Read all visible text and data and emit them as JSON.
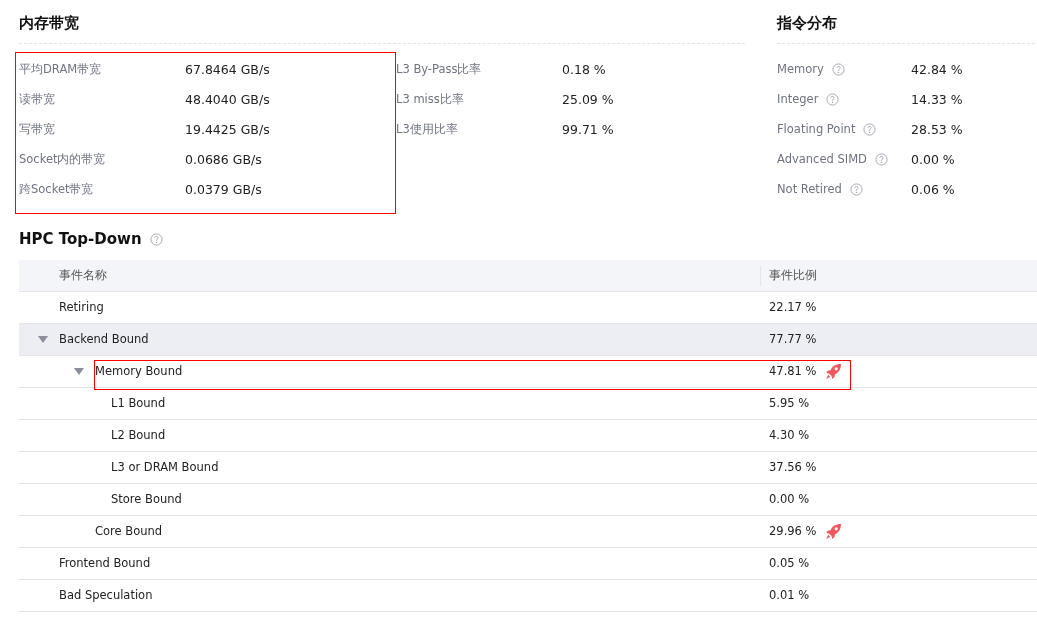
{
  "memory_bandwidth": {
    "title": "内存带宽",
    "group_1": {
      "highlighted": true,
      "items": [
        {
          "label": "平均DRAM带宽",
          "value": "67.8464 GB/s"
        },
        {
          "label": "读带宽",
          "value": "48.4040 GB/s"
        },
        {
          "label": "写带宽",
          "value": "19.4425 GB/s"
        },
        {
          "label": "Socket内的带宽",
          "value": "0.0686 GB/s"
        },
        {
          "label": "跨Socket带宽",
          "value": "0.0379 GB/s"
        }
      ]
    },
    "group_2": {
      "highlighted": false,
      "items": [
        {
          "label": "L3 By-Pass比率",
          "value": "0.18 %"
        },
        {
          "label": "L3 miss比率",
          "value": "25.09 %"
        },
        {
          "label": "L3使用比率",
          "value": "99.71 %"
        }
      ]
    }
  },
  "instruction_distribution": {
    "title": "指令分布",
    "items": [
      {
        "label": "Memory",
        "value": "42.84 %"
      },
      {
        "label": "Integer",
        "value": "14.33 %"
      },
      {
        "label": "Floating Point",
        "value": "28.53 %"
      },
      {
        "label": "Advanced SIMD",
        "value": "0.00 %"
      },
      {
        "label": "Not Retired",
        "value": "0.06 %"
      }
    ]
  },
  "hpc_top_down": {
    "title": "HPC Top-Down",
    "columns": [
      "事件名称",
      "事件比例"
    ],
    "rows": [
      {
        "name": "Retiring",
        "value": "22.17 %",
        "shaded": false,
        "highlighted": false,
        "alert": false
      },
      {
        "name": "Backend Bound",
        "value": "77.77 %",
        "expanded": true,
        "shaded": true,
        "highlighted": false,
        "alert": false,
        "children": [
          {
            "name": "Memory Bound",
            "value": "47.81 %",
            "expanded": true,
            "shaded": false,
            "highlighted": true,
            "alert": true,
            "children": [
              {
                "name": "L1 Bound",
                "value": "5.95 %",
                "shaded": false,
                "highlighted": false,
                "alert": false
              },
              {
                "name": "L2 Bound",
                "value": "4.30 %",
                "shaded": false,
                "highlighted": false,
                "alert": false
              },
              {
                "name": "L3 or DRAM Bound",
                "value": "37.56 %",
                "shaded": false,
                "highlighted": false,
                "alert": false
              },
              {
                "name": "Store Bound",
                "value": "0.00 %",
                "shaded": false,
                "highlighted": false,
                "alert": false
              }
            ]
          },
          {
            "name": "Core Bound",
            "value": "29.96 %",
            "shaded": false,
            "highlighted": false,
            "alert": true
          }
        ]
      },
      {
        "name": "Frontend Bound",
        "value": "0.05 %",
        "shaded": false,
        "highlighted": false,
        "alert": false
      },
      {
        "name": "Bad Speculation",
        "value": "0.01 %",
        "shaded": false,
        "highlighted": false,
        "alert": false
      }
    ]
  }
}
